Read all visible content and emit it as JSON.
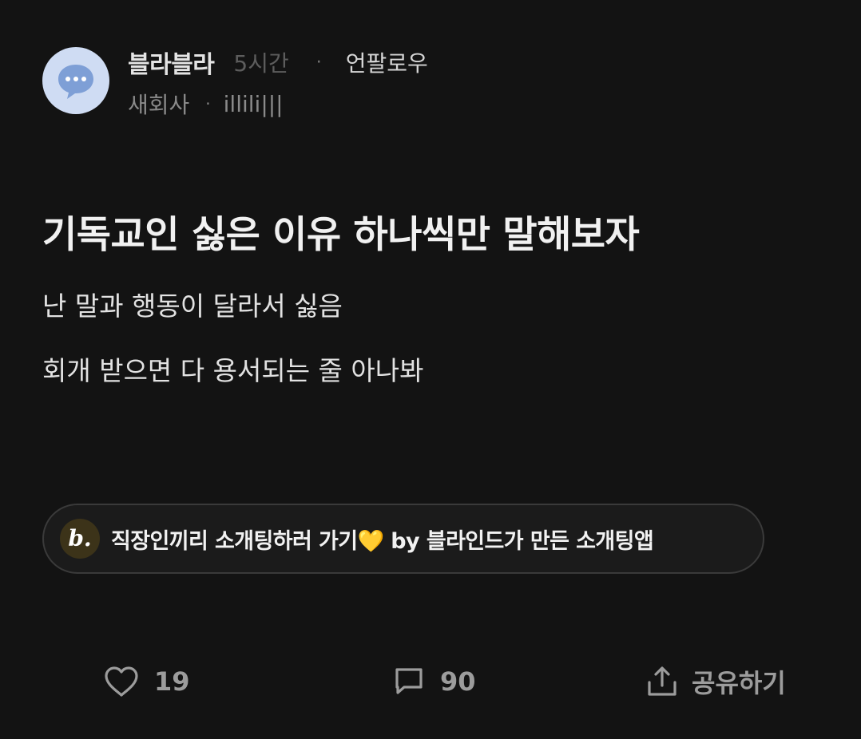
{
  "post": {
    "author": "블라블라",
    "time": "5시간",
    "separator": "·",
    "unfollow_label": "언팔로우",
    "company": "새회사",
    "nickname": "illili|||",
    "title": "기독교인 싫은 이유 하나씩만 말해보자",
    "body_lines": [
      "난 말과 행동이 달라서 싫음",
      "회개 받으면 다 용서되는 줄 아나봐"
    ]
  },
  "banner": {
    "logo_text": "b.",
    "text": "직장인끼리 소개팅하러 가기💛 by 블라인드가 만든 소개팅앱"
  },
  "actions": {
    "likes": "19",
    "comments": "90",
    "share_label": "공유하기"
  },
  "icons": {
    "avatar": "chat-bubble-icon",
    "like": "heart-icon",
    "comment": "comment-icon",
    "share": "share-icon"
  },
  "colors": {
    "background": "#131313",
    "avatar_bg": "#cfdcf3",
    "avatar_icon": "#7e9fd6",
    "logo_bg": "#3c3319"
  }
}
